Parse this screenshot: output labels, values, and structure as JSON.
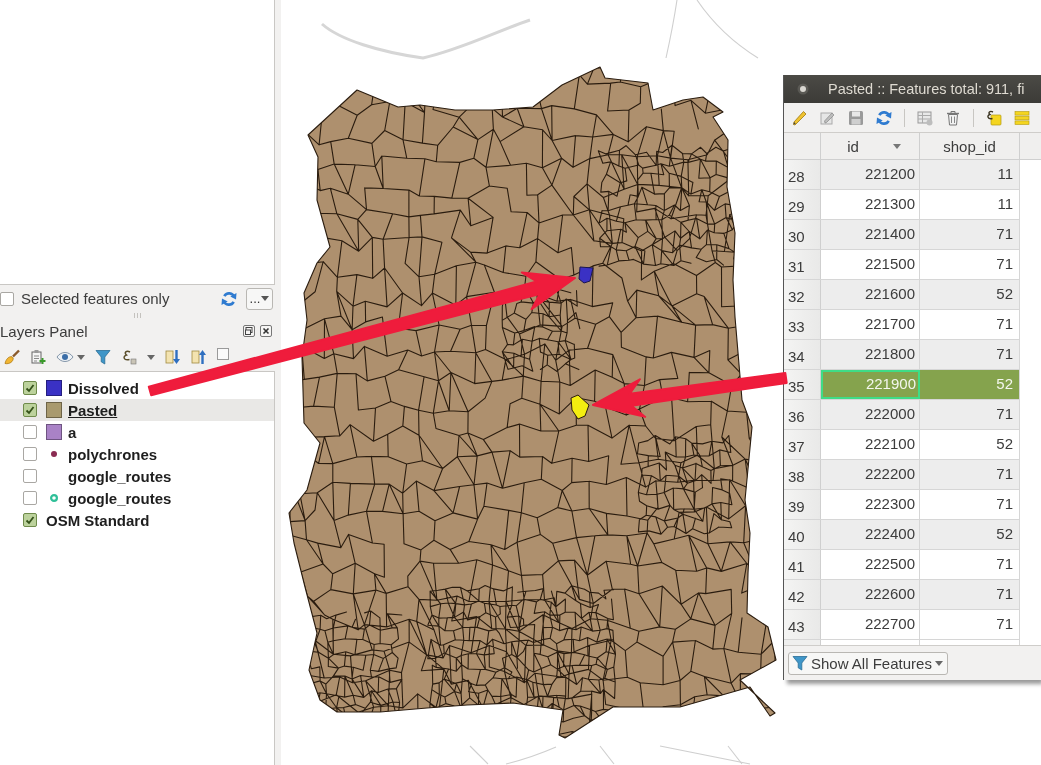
{
  "layer_filter": {
    "label": "Selected features only",
    "checked": false,
    "menu_button": "..."
  },
  "layers_panel": {
    "title": "Layers Panel",
    "layers": [
      {
        "name": "Dissolved",
        "kind": "square",
        "visible": true,
        "selected": false,
        "color": "#3a31c4"
      },
      {
        "name": "Pasted",
        "kind": "square",
        "visible": true,
        "selected": true,
        "color": "#a99a6f"
      },
      {
        "name": "a",
        "kind": "square",
        "visible": false,
        "selected": false,
        "color": "#a982c6"
      },
      {
        "name": "polychrones",
        "kind": "dot",
        "visible": false,
        "selected": false,
        "color": "#8a2b52"
      },
      {
        "name": "google_routes",
        "kind": "blank",
        "visible": false,
        "selected": false
      },
      {
        "name": "google_routes",
        "kind": "ring",
        "visible": false,
        "selected": false,
        "color": "#2fbf98"
      },
      {
        "name": "OSM Standard",
        "kind": "raster",
        "visible": true,
        "selected": false
      }
    ]
  },
  "attribute_table": {
    "title": "Pasted :: Features total: 911, fi",
    "columns": [
      {
        "label": "id",
        "sorted": true
      },
      {
        "label": "shop_id",
        "sorted": false
      }
    ],
    "rows": [
      {
        "number": "28",
        "selected": false,
        "cells": [
          {
            "value": "221200",
            "focused": false
          },
          {
            "value": "11",
            "focused": false
          }
        ]
      },
      {
        "number": "29",
        "selected": false,
        "cells": [
          {
            "value": "221300",
            "focused": false
          },
          {
            "value": "11",
            "focused": false
          }
        ]
      },
      {
        "number": "30",
        "selected": false,
        "cells": [
          {
            "value": "221400",
            "focused": false
          },
          {
            "value": "71",
            "focused": false
          }
        ]
      },
      {
        "number": "31",
        "selected": false,
        "cells": [
          {
            "value": "221500",
            "focused": false
          },
          {
            "value": "71",
            "focused": false
          }
        ]
      },
      {
        "number": "32",
        "selected": false,
        "cells": [
          {
            "value": "221600",
            "focused": false
          },
          {
            "value": "52",
            "focused": false
          }
        ]
      },
      {
        "number": "33",
        "selected": false,
        "cells": [
          {
            "value": "221700",
            "focused": false
          },
          {
            "value": "71",
            "focused": false
          }
        ]
      },
      {
        "number": "34",
        "selected": false,
        "cells": [
          {
            "value": "221800",
            "focused": false
          },
          {
            "value": "71",
            "focused": false
          }
        ]
      },
      {
        "number": "35",
        "selected": true,
        "cells": [
          {
            "value": "221900",
            "focused": true
          },
          {
            "value": "52",
            "focused": false
          }
        ]
      },
      {
        "number": "36",
        "selected": false,
        "cells": [
          {
            "value": "222000",
            "focused": false
          },
          {
            "value": "71",
            "focused": false
          }
        ]
      },
      {
        "number": "37",
        "selected": false,
        "cells": [
          {
            "value": "222100",
            "focused": false
          },
          {
            "value": "52",
            "focused": false
          }
        ]
      },
      {
        "number": "38",
        "selected": false,
        "cells": [
          {
            "value": "222200",
            "focused": false
          },
          {
            "value": "71",
            "focused": false
          }
        ]
      },
      {
        "number": "39",
        "selected": false,
        "cells": [
          {
            "value": "222300",
            "focused": false
          },
          {
            "value": "71",
            "focused": false
          }
        ]
      },
      {
        "number": "40",
        "selected": false,
        "cells": [
          {
            "value": "222400",
            "focused": false
          },
          {
            "value": "52",
            "focused": false
          }
        ]
      },
      {
        "number": "41",
        "selected": false,
        "cells": [
          {
            "value": "222500",
            "focused": false
          },
          {
            "value": "71",
            "focused": false
          }
        ]
      },
      {
        "number": "42",
        "selected": false,
        "cells": [
          {
            "value": "222600",
            "focused": false
          },
          {
            "value": "71",
            "focused": false
          }
        ]
      },
      {
        "number": "43",
        "selected": false,
        "cells": [
          {
            "value": "222700",
            "focused": false
          },
          {
            "value": "71",
            "focused": false
          }
        ]
      }
    ],
    "filter_button": "Show All Features"
  }
}
